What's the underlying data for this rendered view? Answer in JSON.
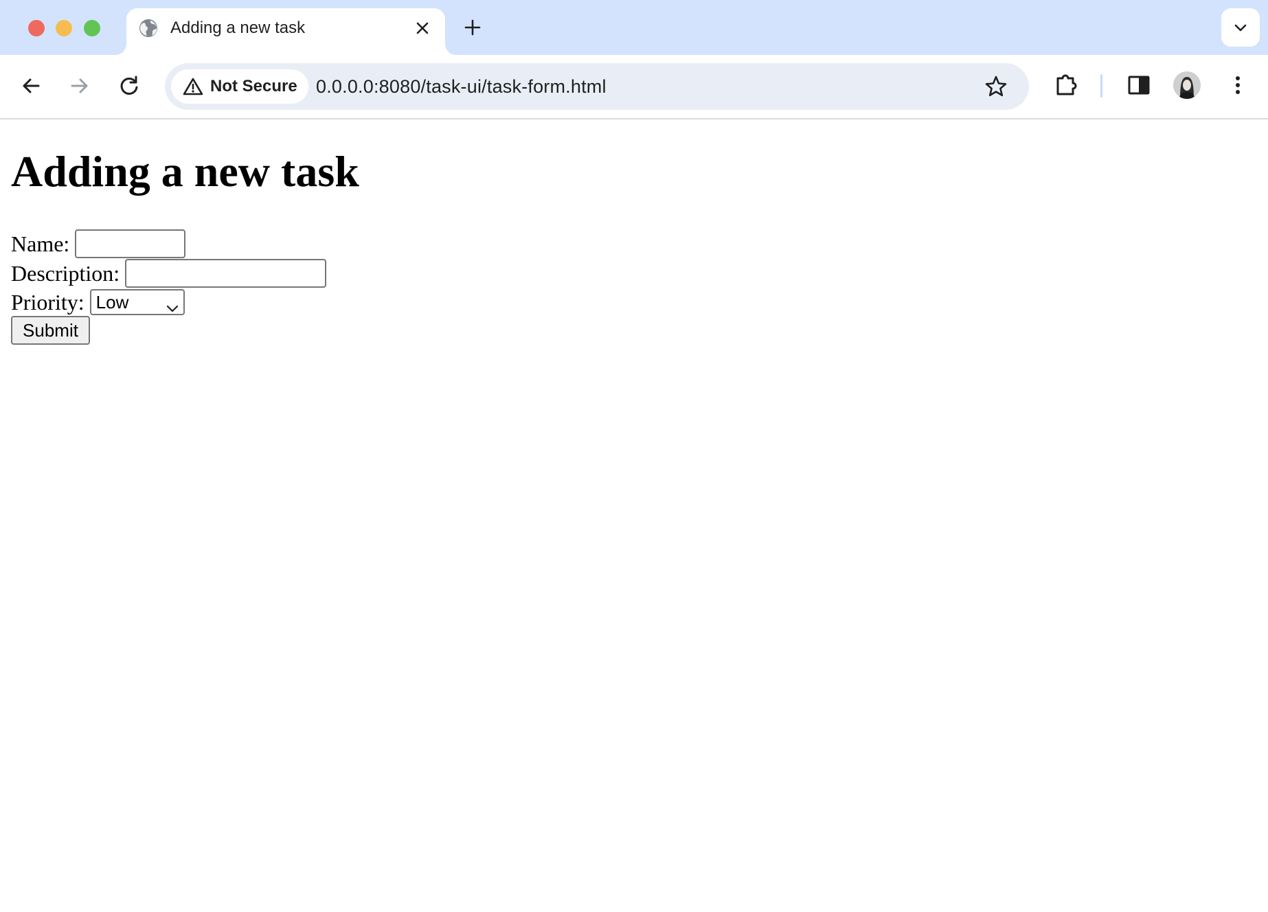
{
  "browser": {
    "tab": {
      "title": "Adding a new task",
      "favicon": "globe-icon"
    },
    "omnibox": {
      "security_label": "Not Secure",
      "url": "0.0.0.0:8080/task-ui/task-form.html"
    },
    "toolbar_icons": [
      "back-arrow-icon",
      "forward-arrow-icon",
      "reload-icon",
      "star-icon",
      "extensions-icon",
      "side-panel-icon",
      "avatar",
      "more-vert-icon"
    ]
  },
  "page": {
    "heading": "Adding a new task",
    "form": {
      "name_label": "Name:",
      "name_value": "",
      "description_label": "Description:",
      "description_value": "",
      "priority_label": "Priority:",
      "priority_selected": "Low",
      "submit_label": "Submit"
    }
  },
  "colors": {
    "tabstrip_bg": "#d3e3fd",
    "omnibox_bg": "#e9eef6",
    "traffic_red": "#ee6a5f",
    "traffic_yellow": "#f5bd4f",
    "traffic_green": "#61c454"
  }
}
